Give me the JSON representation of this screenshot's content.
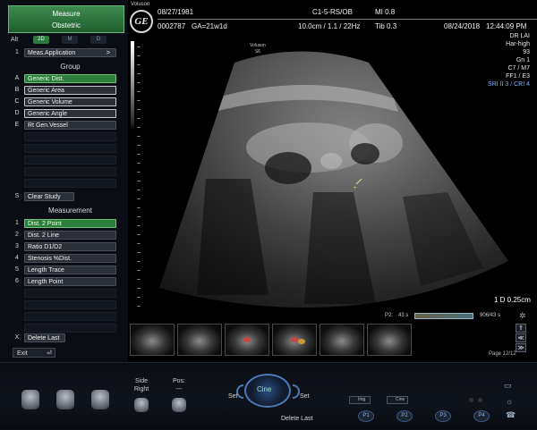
{
  "left_panel": {
    "title_line1": "Measure",
    "title_line2": "Obstetric",
    "alt_label": "Alt",
    "alt_buttons": [
      "2D",
      "M",
      "D"
    ],
    "meas_app": {
      "key": "1",
      "label": "Meas.Application",
      "arrow": ">"
    },
    "group_header": "Group",
    "group_items": [
      {
        "key": "A",
        "label": "Generic Dist."
      },
      {
        "key": "B",
        "label": "Generic Area"
      },
      {
        "key": "C",
        "label": "Generic Volume"
      },
      {
        "key": "D",
        "label": "Generic Angle"
      },
      {
        "key": "E",
        "label": "Rt Gen.Vessel"
      }
    ],
    "clear_study": {
      "key": "S",
      "label": "Clear Study"
    },
    "measurement_header": "Measurement",
    "measurement_items": [
      {
        "key": "1",
        "label": "Dist. 2 Point"
      },
      {
        "key": "2",
        "label": "Dist. 2 Line"
      },
      {
        "key": "3",
        "label": "Ratio D1/D2"
      },
      {
        "key": "4",
        "label": "Stenosis %Dist."
      },
      {
        "key": "5",
        "label": "Length Trace"
      },
      {
        "key": "6",
        "label": "Length Point"
      }
    ],
    "delete_last": {
      "key": "X",
      "label": "Delete Last"
    },
    "exit_label": "Exit"
  },
  "header": {
    "brand": "GE",
    "brand_caption": "Voluson",
    "dob": "08/27/1981",
    "patient_id": "0002787",
    "ga": "GA=21w1d",
    "probe": "C1-5-RS/OB",
    "depth_info": "10.0cm / 1.1 / 22Hz",
    "mi": "MI  0.8",
    "tib": "Tib  0.3",
    "date": "08/24/2018",
    "time": "12:44:09 PM"
  },
  "right_info": {
    "lines": [
      "DR LAI",
      "Har-high",
      "93",
      "Gn  1",
      "C7 / M7",
      "FF1 / E3"
    ],
    "sri": "SRI II 3 / CRI 4"
  },
  "image": {
    "probe_label_line1": "Voluson",
    "probe_label_line2": "S6",
    "measurement_readout": "1  D 0.25cm"
  },
  "cine": {
    "p2_label": "P2:",
    "left_time": "43 s",
    "frames": "906/43 s",
    "page": "Page 12/12"
  },
  "console": {
    "side_label": "Side",
    "side_value": "Right",
    "pos_label": "Pos:",
    "pos_value": "---",
    "set_left": "Set",
    "set_right": "Set",
    "center_label": "Cine",
    "delete_last": "Delete Last",
    "img_label": "Img",
    "cine_label": "Cine",
    "p_buttons": [
      "P1",
      "P2",
      "P3",
      "P4"
    ]
  },
  "colors": {
    "accent_green": "#2d7e3d",
    "sri_blue": "#7fb2ff",
    "ring_blue": "#4a7bb8"
  }
}
